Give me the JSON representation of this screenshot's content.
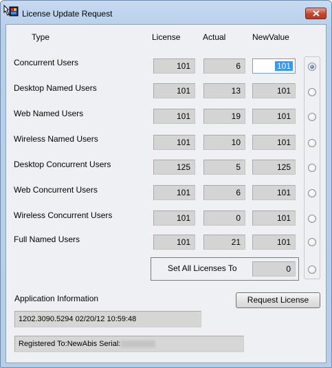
{
  "window": {
    "title": "License Update Request"
  },
  "headers": {
    "type": "Type",
    "license": "License",
    "actual": "Actual",
    "new_value": "NewValue"
  },
  "rows": [
    {
      "label": "Concurrent Users",
      "license": "101",
      "actual": "6",
      "new_value": "101",
      "selected": true
    },
    {
      "label": "Desktop Named Users",
      "license": "101",
      "actual": "13",
      "new_value": "101",
      "selected": false
    },
    {
      "label": "Web Named Users",
      "license": "101",
      "actual": "19",
      "new_value": "101",
      "selected": false
    },
    {
      "label": "Wireless Named Users",
      "license": "101",
      "actual": "10",
      "new_value": "101",
      "selected": false
    },
    {
      "label": "Desktop Concurrent Users",
      "license": "125",
      "actual": "5",
      "new_value": "125",
      "selected": false
    },
    {
      "label": "Web Concurrent Users",
      "license": "101",
      "actual": "6",
      "new_value": "101",
      "selected": false
    },
    {
      "label": "Wireless Concurrent Users",
      "license": "101",
      "actual": "0",
      "new_value": "101",
      "selected": false
    },
    {
      "label": "Full Named Users",
      "license": "101",
      "actual": "21",
      "new_value": "101",
      "selected": false
    }
  ],
  "set_all": {
    "label": "Set All Licenses To",
    "value": "0",
    "selected": false
  },
  "application_info": {
    "label": "Application Information",
    "version": "1202.3090.5294 02/20/12 10:59:48",
    "registered": "Registered To:NewAbis Serial:"
  },
  "request_button": {
    "label": "Request License"
  },
  "icons": {
    "app": "license-app-icon",
    "close": "close-icon"
  },
  "colors": {
    "selection": "#3399ff",
    "close_button": "#c7442c"
  }
}
